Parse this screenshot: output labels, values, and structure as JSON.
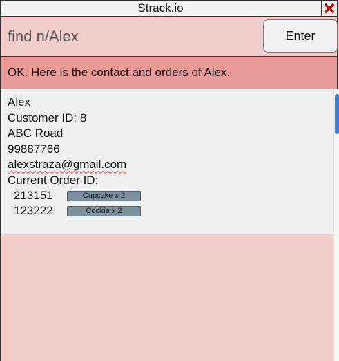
{
  "window": {
    "title": "Strack.io",
    "close_icon": "close-x-icon",
    "close_color": "#cc0000"
  },
  "command": {
    "value": "find n/Alex",
    "enter_label": "Enter"
  },
  "response": {
    "message": "OK. Here is the contact and orders of Alex."
  },
  "contact": {
    "name": "Alex",
    "customer_id": "Customer ID: 8",
    "address": "ABC Road",
    "phone": "99887766",
    "email": "alexstraza@gmail.com",
    "orders_heading": "Current Order ID:",
    "orders": [
      {
        "id": "213151",
        "item": "Cupcake x 2"
      },
      {
        "id": "123222",
        "item": "Cookie x 2"
      }
    ]
  },
  "colors": {
    "background": "#f4cccc",
    "response_bg": "#ea9999",
    "result_bg": "#f0f0f0",
    "tag_bg": "#7d909e",
    "scroll_accent": "#3d7fd6"
  }
}
